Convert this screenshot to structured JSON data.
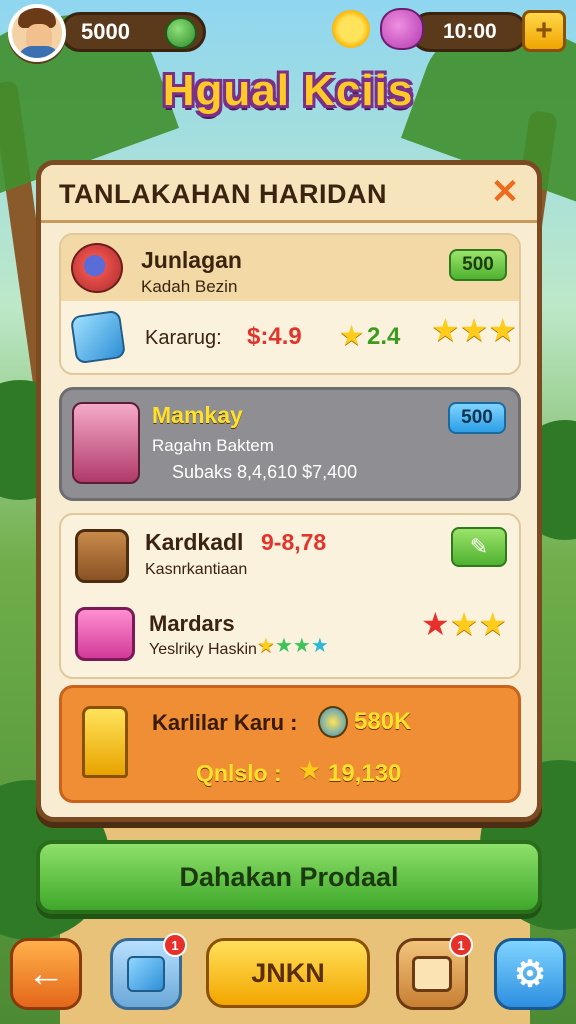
{
  "hud": {
    "coins": "5000",
    "time": "10:00",
    "plus_label": "+"
  },
  "game_title": "Hgual Kciis",
  "panel": {
    "title": "TANLAKAHAN HARIDAN",
    "close_label": "✕",
    "cards": [
      {
        "title": "Junlagan",
        "subtitle": "Kadah Bezin",
        "badge": "500",
        "line_label": "Kararug:",
        "line_value_red": "$:4.9",
        "line_value_green": "2.4"
      },
      {
        "title": "Mamkay",
        "subtitle": "Ragahn Baktem",
        "detail": "Subaks 8,4,610 $7,400",
        "badge": "500"
      },
      {
        "title": "Kardkadl",
        "title_value": "9-8,78",
        "subtitle": "Kasnrkantiaan",
        "item2_title": "Mardars",
        "item2_subtitle": "Yeslriky Haskin"
      },
      {
        "line1_label": "Karlilar Karu :",
        "line1_value": "580K",
        "line2_label": "Qnlslo :",
        "line2_value": "19,130"
      }
    ]
  },
  "cta_label": "Dahakan Prodaal",
  "nav": {
    "main_label": "JNKN",
    "cube_badge": "1",
    "box_badge": "1"
  },
  "colors": {
    "panel_bg": "#f8ecd2",
    "panel_border": "#7a4a22",
    "title_fill": "#ffc928",
    "title_outline": "#7a2f88",
    "cta_green": "#3ea82a",
    "reward_orange": "#ef8e34"
  }
}
